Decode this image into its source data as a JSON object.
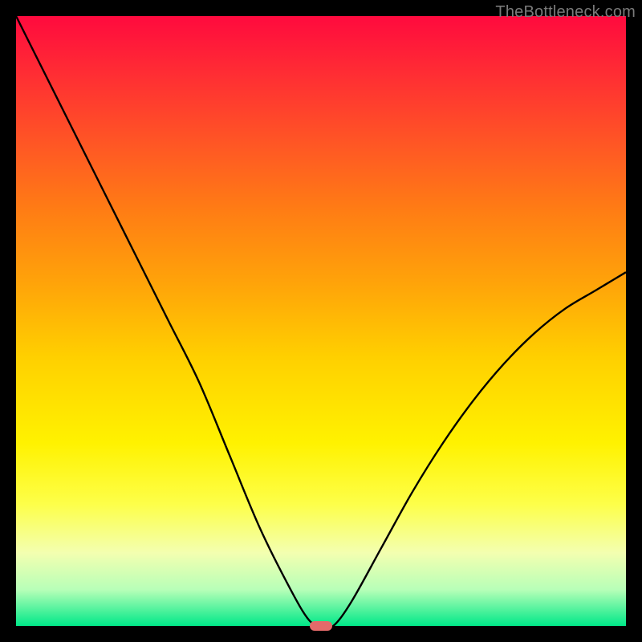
{
  "watermark": "TheBottleneck.com",
  "chart_data": {
    "type": "line",
    "title": "",
    "xlabel": "",
    "ylabel": "",
    "xlim": [
      0,
      100
    ],
    "ylim": [
      0,
      100
    ],
    "grid": false,
    "x": [
      0,
      5,
      10,
      15,
      20,
      25,
      30,
      35,
      40,
      45,
      48,
      50,
      52,
      55,
      60,
      65,
      70,
      75,
      80,
      85,
      90,
      95,
      100
    ],
    "values": [
      100,
      90,
      80,
      70,
      60,
      50,
      40,
      28,
      16,
      6,
      1,
      0,
      0,
      4,
      13,
      22,
      30,
      37,
      43,
      48,
      52,
      55,
      58
    ],
    "minimum_marker": {
      "x": 50,
      "y": 0
    },
    "background_gradient": {
      "top_color": "#ff0a3e",
      "mid_color": "#fff200",
      "bottom_color": "#00e888"
    },
    "curve_color": "#000000",
    "marker_color": "#e46a6a"
  }
}
